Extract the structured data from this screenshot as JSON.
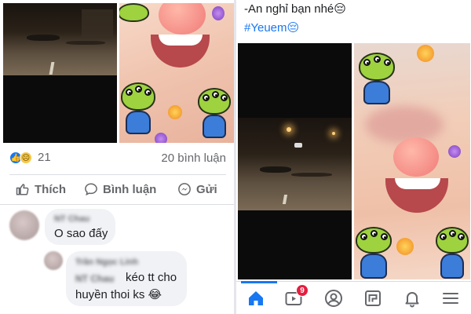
{
  "left_post": {
    "reaction_count": "21",
    "comment_count": "20 bình luận",
    "actions": {
      "like": "Thích",
      "comment": "Bình luận",
      "share": "Gửi"
    }
  },
  "comments": [
    {
      "name_blurred": "NT Chau",
      "text": "O sao đấy"
    },
    {
      "name_blurred": "Trần Ngọc Linh",
      "mention_blurred": "NT Chau",
      "text_line1": "kéo tt cho",
      "text_line2": "huyền thoi ks 😂"
    }
  ],
  "right_post": {
    "caption_line1": "-An nghỉ bạn nhé😔",
    "caption_line2": "#Yeuem😔"
  },
  "bottom_nav": {
    "active": "home",
    "items": [
      "home-icon",
      "watch-icon",
      "profile-icon",
      "pages-icon",
      "notifications-icon",
      "menu-icon"
    ],
    "watch_badge": "9"
  },
  "colors": {
    "facebook_blue": "#1877f2",
    "badge_red": "#e41e3f",
    "secondary_text": "#65676b"
  }
}
